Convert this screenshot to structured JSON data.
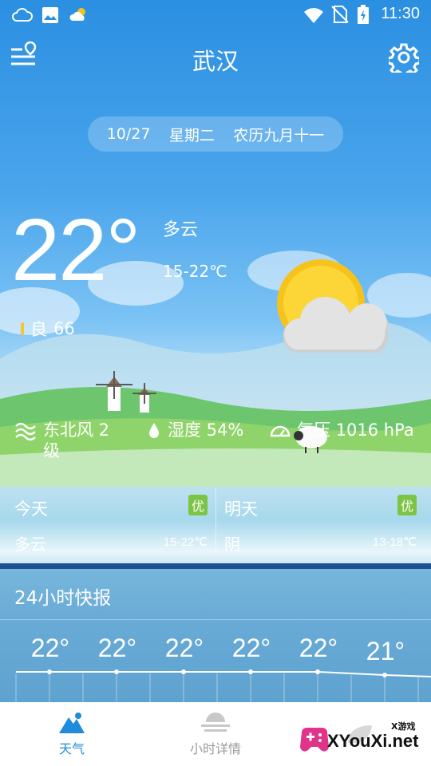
{
  "status_bar": {
    "time": "11:30"
  },
  "header": {
    "city": "武汉"
  },
  "date_pill": {
    "date": "10/27",
    "weekday": "星期二",
    "lunar": "农历九月十一"
  },
  "current": {
    "temp": "22°",
    "condition": "多云",
    "range": "15-22℃",
    "aqi_label": "良",
    "aqi_value": "66"
  },
  "metrics": {
    "wind": "东北风 2",
    "wind_level": "级",
    "humidity": "湿度 54%",
    "pressure": "气压 1016 hPa"
  },
  "today": {
    "label": "今天",
    "badge": "优",
    "condition": "多云",
    "range": "15-22℃"
  },
  "tomorrow": {
    "label": "明天",
    "badge": "优",
    "condition": "阴",
    "range": "13-18℃"
  },
  "hourly": {
    "title": "24小时快报",
    "temps": [
      "22°",
      "22°",
      "22°",
      "22°",
      "22°",
      "21°"
    ]
  },
  "nav": {
    "weather": "天气",
    "hourly": "小时详情"
  },
  "watermark": {
    "small": "X游戏",
    "big": "XYouXi.net"
  },
  "colors": {
    "accent": "#1f8bdc",
    "badge": "#7bc444",
    "sun": "#f6c21c"
  }
}
